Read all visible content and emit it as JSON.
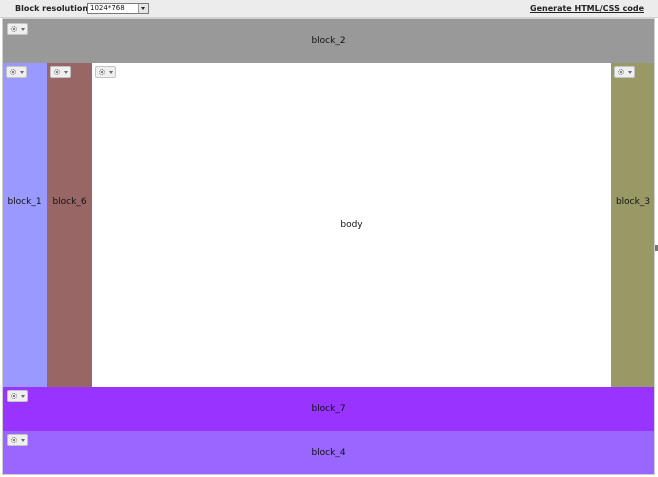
{
  "toolbar": {
    "resolution_label": "Block resolution:",
    "resolution_value": "1024*768",
    "generate_link": "Generate HTML/CSS code"
  },
  "blocks": {
    "block_2": {
      "label": "block_2",
      "color": "#999999"
    },
    "block_1": {
      "label": "block_1",
      "color": "#9999ff"
    },
    "block_6": {
      "label": "block_6",
      "color": "#996666"
    },
    "body": {
      "label": "body",
      "color": "#ffffff"
    },
    "block_3": {
      "label": "block_3",
      "color": "#999966"
    },
    "block_7": {
      "label": "block_7",
      "color": "#9933ff"
    },
    "block_4": {
      "label": "block_4",
      "color": "#9966ff"
    }
  },
  "icons": {
    "gear": "gear-icon",
    "caret": "caret-down-icon"
  }
}
